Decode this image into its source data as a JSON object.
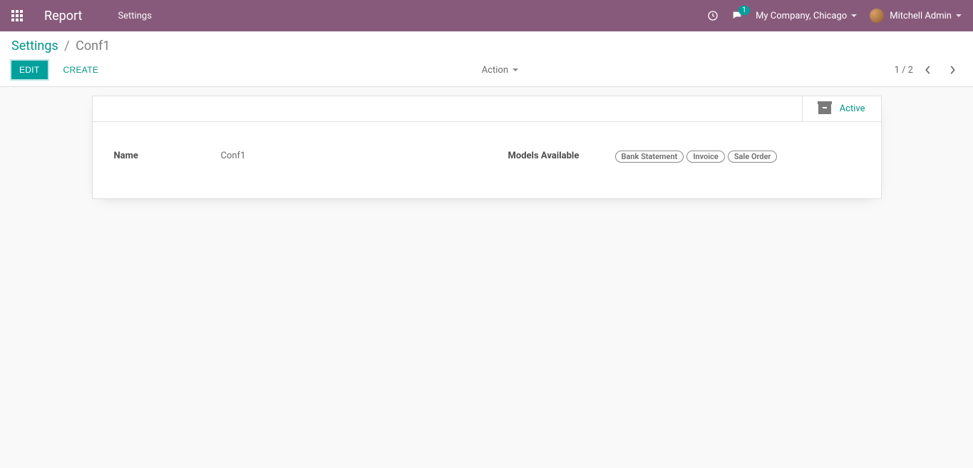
{
  "navbar": {
    "brand": "Report",
    "menu": [
      "Settings"
    ],
    "notifications_count": "1",
    "company": "My Company, Chicago",
    "user": "Mitchell Admin"
  },
  "breadcrumb": {
    "parent": "Settings",
    "current": "Conf1"
  },
  "buttons": {
    "edit": "EDIT",
    "create": "CREATE",
    "action": "Action"
  },
  "pager": {
    "text": "1 / 2"
  },
  "status": {
    "active_label": "Active"
  },
  "form": {
    "name_label": "Name",
    "name_value": "Conf1",
    "models_label": "Models Available",
    "models": [
      "Bank Statement",
      "Invoice",
      "Sale Order"
    ]
  }
}
